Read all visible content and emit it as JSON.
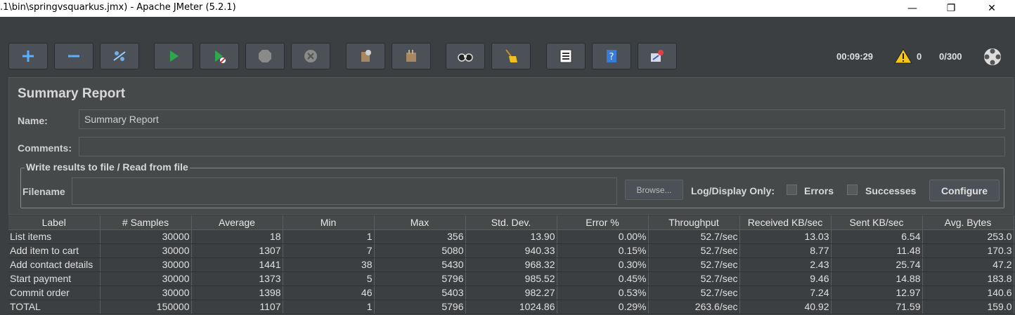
{
  "window": {
    "title": ".1\\bin\\springvsquarkus.jmx) - Apache JMeter (5.2.1)",
    "min_glyph": "—",
    "max_glyph": "❐",
    "close_glyph": "✕"
  },
  "toolbar": {
    "buttons": [
      {
        "name": "add-icon"
      },
      {
        "name": "remove-icon"
      },
      {
        "name": "toggle-icon"
      },
      {
        "name": "start-icon"
      },
      {
        "name": "start-no-pauses-icon"
      },
      {
        "name": "stop-icon"
      },
      {
        "name": "shutdown-icon"
      },
      {
        "name": "clear-icon"
      },
      {
        "name": "clear-all-icon"
      },
      {
        "name": "search-icon"
      },
      {
        "name": "reset-search-icon"
      },
      {
        "name": "function-helper-icon"
      },
      {
        "name": "help-icon"
      },
      {
        "name": "remote-icon"
      }
    ],
    "elapsed_time": "00:09:29",
    "warning_count": "0",
    "threads": "0/300"
  },
  "panel": {
    "title": "Summary Report",
    "name_label": "Name:",
    "name_value": "Summary Report",
    "comments_label": "Comments:",
    "comments_value": "",
    "group_title": "Write results to file / Read from file",
    "filename_label": "Filename",
    "filename_value": "",
    "browse_label": "Browse...",
    "log_display_label": "Log/Display Only:",
    "errors_label": "Errors",
    "successes_label": "Successes",
    "configure_label": "Configure"
  },
  "table": {
    "columns": [
      "Label",
      "# Samples",
      "Average",
      "Min",
      "Max",
      "Std. Dev.",
      "Error %",
      "Throughput",
      "Received KB/sec",
      "Sent KB/sec",
      "Avg. Bytes"
    ],
    "rows": [
      [
        "List items",
        "30000",
        "18",
        "1",
        "356",
        "13.90",
        "0.00%",
        "52.7/sec",
        "13.03",
        "6.54",
        "253.0"
      ],
      [
        "Add item to cart",
        "30000",
        "1307",
        "7",
        "5080",
        "940.33",
        "0.15%",
        "52.7/sec",
        "8.77",
        "11.48",
        "170.3"
      ],
      [
        "Add contact details",
        "30000",
        "1441",
        "38",
        "5430",
        "968.32",
        "0.30%",
        "52.7/sec",
        "2.43",
        "25.74",
        "47.2"
      ],
      [
        "Start payment",
        "30000",
        "1373",
        "5",
        "5796",
        "985.52",
        "0.45%",
        "52.7/sec",
        "9.46",
        "14.88",
        "183.8"
      ],
      [
        "Commit order",
        "30000",
        "1398",
        "46",
        "5403",
        "982.27",
        "0.53%",
        "52.7/sec",
        "7.24",
        "12.97",
        "140.6"
      ],
      [
        "TOTAL",
        "150000",
        "1107",
        "1",
        "5796",
        "1024.86",
        "0.29%",
        "263.6/sec",
        "40.92",
        "71.59",
        "159.0"
      ]
    ]
  }
}
